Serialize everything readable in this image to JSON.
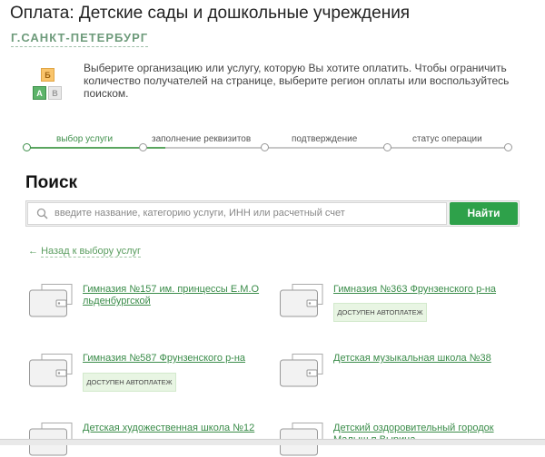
{
  "page": {
    "title": "Оплата: Детские сады и дошкольные учреждения",
    "region": "Г.САНКТ-ПЕТЕРБУРГ",
    "intro": "Выберите организацию или услугу, которую Вы хотите оплатить. Чтобы ограничить количество получателей на странице, выберите регион оплаты или воспользуйтесь поиском.",
    "cubes": {
      "b": "Б",
      "a": "А",
      "v": "В"
    }
  },
  "steps": [
    {
      "label": "выбор услуги",
      "active": true
    },
    {
      "label": "заполнение реквизитов",
      "active": false
    },
    {
      "label": "подтверждение",
      "active": false
    },
    {
      "label": "статус операции",
      "active": false
    }
  ],
  "search": {
    "heading": "Поиск",
    "placeholder": "введите название, категорию услуги, ИНН или расчетный счет",
    "button": "Найти"
  },
  "back_link": {
    "arrow": "←",
    "label": "Назад к выбору услуг"
  },
  "organizations": [
    {
      "name_line1": "Гимназия №157 им. принцессы Е.М.О",
      "name_line2": "льденбургской",
      "badge": ""
    },
    {
      "name_line1": "Гимназия №363 Фрунзенского р-на",
      "name_line2": "",
      "badge": "ДОСТУПЕН АВТОПЛАТЕЖ"
    },
    {
      "name_line1": "Гимназия №587 Фрунзенского р-на",
      "name_line2": "",
      "badge": "ДОСТУПЕН АВТОПЛАТЕЖ"
    },
    {
      "name_line1": "Детская музыкальная школа №38",
      "name_line2": "",
      "badge": ""
    },
    {
      "name_line1": "Детская художественная школа №12",
      "name_line2": "",
      "badge": ""
    },
    {
      "name_line1": "Детский оздоровительный городок",
      "name_line2": "Малыш п.Вырица",
      "badge": ""
    }
  ],
  "colors": {
    "accent": "#2ea14a",
    "link": "#3a8c49"
  }
}
